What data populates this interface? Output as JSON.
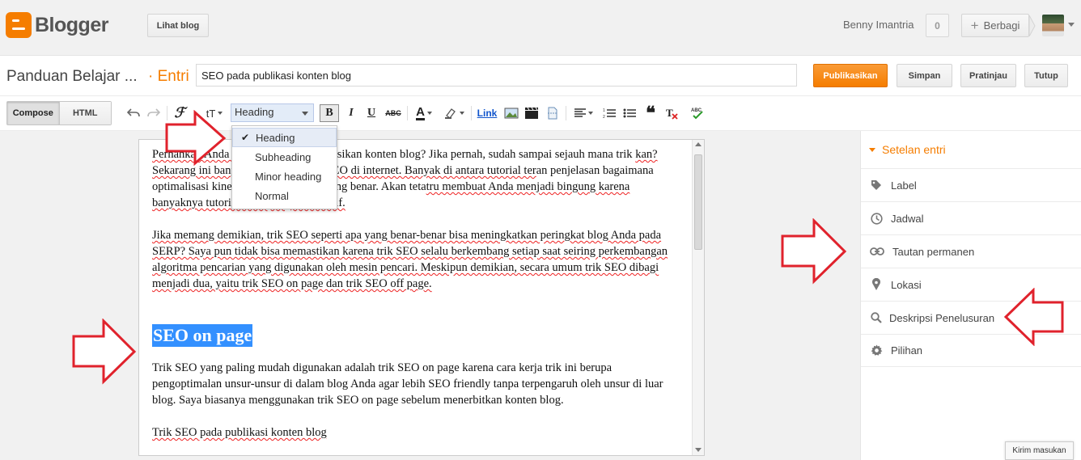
{
  "header": {
    "brand": "Blogger",
    "view_blog": "Lihat blog",
    "user_name": "Benny Imantria",
    "notification_count": "0",
    "share_label": "Berbagi"
  },
  "post": {
    "blog_title": "Panduan Belajar ...",
    "section": "· Entri",
    "title_value": "SEO pada publikasi konten blog",
    "publish": "Publikasikan",
    "save": "Simpan",
    "preview": "Pratinjau",
    "close": "Tutup"
  },
  "toolbar": {
    "compose": "Compose",
    "html": "HTML",
    "format_selected": "Heading",
    "link": "Link",
    "font_size": "tT"
  },
  "format_menu": {
    "items": [
      "Heading",
      "Subheading",
      "Minor heading",
      "Normal"
    ],
    "selected": "Heading"
  },
  "editor": {
    "p1_a": "Pernahkah Anda ",
    "p1_b": "SEO saat mempublikasikan konten blog? Jika pernah, sudah sampai sejauh mana trik ",
    "p1_c": "kan? Sekarang ini banyak beredar tutorial SEO di internet. Banyak di antara tutorial ter",
    "p1_d": "an penjelasan bagaimana optimalisasi kinerja blog lewat SEO yang benar. Akan teta",
    "p1_e": "tru membuat Anda menjadi bingung karena banyaknya tutorial SEO yang bervariatif.",
    "p2": "Jika memang demikian, trik SEO seperti apa yang benar-benar bisa meningkatkan peringkat blog Anda pada SERP? Saya pun tidak bisa memastikan karena trik SEO selalu berkembang setiap saat seiring perkembangan algoritma pencarian yang digunakan oleh mesin pencari. Meskipun demikian, secara umum trik SEO dibagi menjadi dua, yaitu trik SEO on page dan trik SEO off page.",
    "heading": "SEO on page",
    "p3": "Trik SEO yang paling mudah digunakan adalah trik SEO on page karena cara kerja trik ini berupa pengoptimalan unsur-unsur di dalam blog Anda agar lebih SEO friendly tanpa terpengaruh oleh unsur di luar blog. Saya biasanya menggunakan trik SEO on page sebelum menerbitkan konten blog.",
    "p4": "Trik SEO pada publikasi konten blog"
  },
  "sidebar": {
    "title": "Setelan entri",
    "items": [
      {
        "label": "Label",
        "icon": "tag-icon"
      },
      {
        "label": "Jadwal",
        "icon": "clock-icon"
      },
      {
        "label": "Tautan permanen",
        "icon": "link-icon"
      },
      {
        "label": "Lokasi",
        "icon": "location-pin-icon"
      },
      {
        "label": "Deskripsi Penelusuran",
        "icon": "search-icon"
      },
      {
        "label": "Pilihan",
        "icon": "gear-icon"
      }
    ]
  },
  "feedback": "Kirim masukan",
  "colors": {
    "brand_orange": "#f57d00",
    "selection_blue": "#3390ff",
    "annotation_red": "#e0222c"
  }
}
